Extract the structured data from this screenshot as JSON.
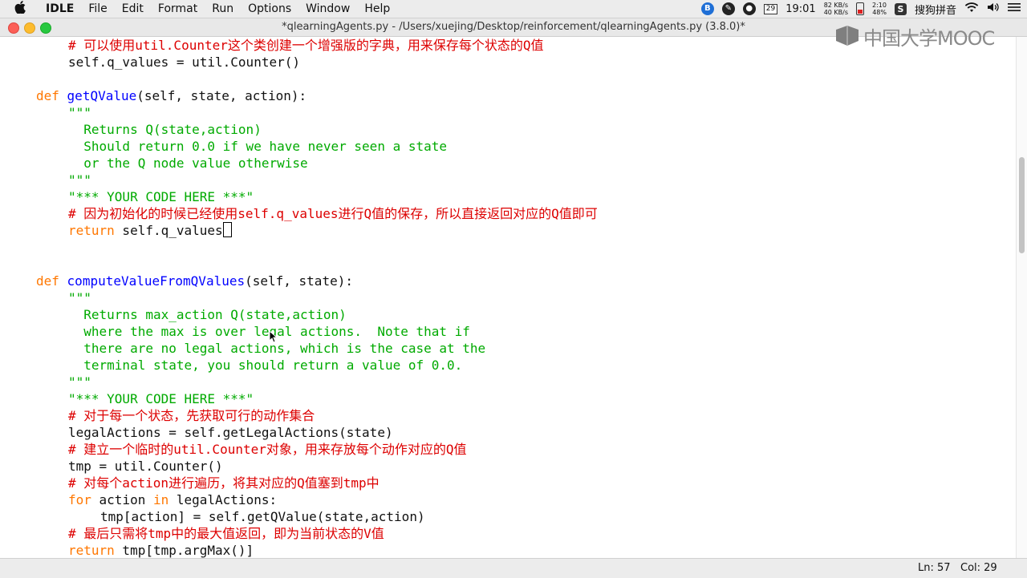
{
  "menubar": {
    "app_name": "IDLE",
    "menus": [
      "File",
      "Edit",
      "Format",
      "Run",
      "Options",
      "Window",
      "Help"
    ],
    "status": {
      "date_badge": "29",
      "clock": "19:01",
      "net_up": "82 KB/s",
      "net_down": "40 KB/s",
      "battery_time": "2:10",
      "battery_percent": "48%",
      "input_method": "搜狗拼音"
    }
  },
  "window": {
    "title": "*qlearningAgents.py - /Users/xuejing/Desktop/reinforcement/qlearningAgents.py (3.8.0)*"
  },
  "watermark": {
    "text": "中国大学MOOC"
  },
  "code": {
    "l1": "# 可以使用util.Counter这个类创建一个增强版的字典，用来保存每个状态的Q值",
    "l2": "self.q_values = util.Counter()",
    "l3_kw": "def",
    "l3_name": "getQValue",
    "l3_rest": "(self, state, action):",
    "l4": "\"\"\"",
    "l5": "  Returns Q(state,action)",
    "l6": "  Should return 0.0 if we have never seen a state",
    "l7": "  or the Q node value otherwise",
    "l8": "\"\"\"",
    "l9": "\"*** YOUR CODE HERE ***\"",
    "l10": "# 因为初始化的时候已经使用self.q_values进行Q值的保存，所以直接返回对应的Q值即可",
    "l11_kw": "return",
    "l11_rest": " self.q_values",
    "l12_kw": "def",
    "l12_name": "computeValueFromQValues",
    "l12_rest": "(self, state):",
    "l13": "\"\"\"",
    "l14": "  Returns max_action Q(state,action)",
    "l15": "  where the max is over legal actions.  Note that if",
    "l16": "  there are no legal actions, which is the case at the",
    "l17": "  terminal state, you should return a value of 0.0.",
    "l18": "\"\"\"",
    "l19": "\"*** YOUR CODE HERE ***\"",
    "l20": "# 对于每一个状态，先获取可行的动作集合",
    "l21": "legalActions = self.getLegalActions(state)",
    "l22": "# 建立一个临时的util.Counter对象，用来存放每个动作对应的Q值",
    "l23": "tmp = util.Counter()",
    "l24": "# 对每个action进行遍历，将其对应的Q值塞到tmp中",
    "l25_kw": "for",
    "l25_a": " action ",
    "l25_kw2": "in",
    "l25_b": " legalActions:",
    "l26": "tmp[action] = self.getQValue(state,action)",
    "l27": "# 最后只需将tmp中的最大值返回，即为当前状态的V值",
    "l28_kw": "return",
    "l28_rest": " tmp[tmp.argMax()]"
  },
  "statusbar": {
    "ln": "Ln: 57",
    "col": "Col: 29"
  }
}
